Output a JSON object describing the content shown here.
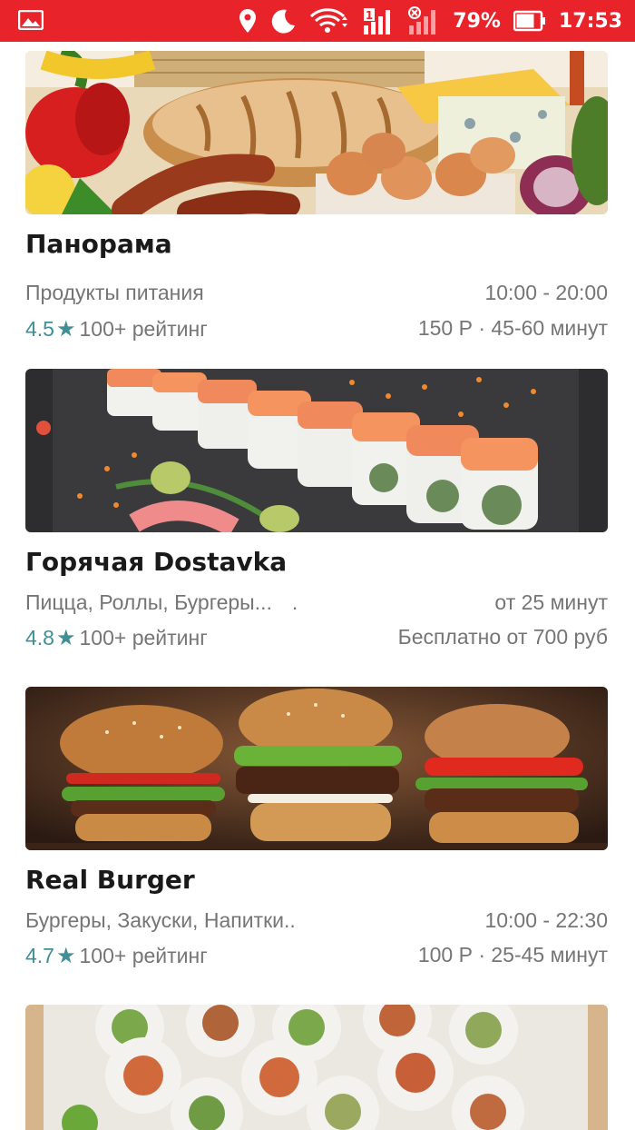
{
  "status_bar": {
    "battery": "79%",
    "time": "17:53",
    "sim_label": "1",
    "icons": [
      "gallery-notification-icon",
      "location-icon",
      "moon-icon",
      "wifi-icon",
      "signal-icon",
      "no-signal-icon",
      "battery-icon"
    ],
    "color": "#e8232a"
  },
  "restaurants": [
    {
      "name": "Панорама",
      "categories": "Продукты питания",
      "hours": "10:00 - 20:00",
      "rating": "4.5",
      "rating_count": "100+ рейтинг",
      "delivery": "150 Р · 45-60 минут",
      "image": "groceries-photo"
    },
    {
      "name": "Горячая Dostavka",
      "categories": "Пицца, Роллы, Бургеры...",
      "extra_dot": ".",
      "hours": "от 25 минут",
      "rating": "4.8",
      "rating_count": "100+ рейтинг",
      "delivery": "Бесплатно от 700 руб",
      "image": "sushi-rolls-photo"
    },
    {
      "name": "Real Burger",
      "categories": "Бургеры, Закуски, Напитки..",
      "hours": "10:00 - 22:30",
      "rating": "4.7",
      "rating_count": "100+ рейтинг",
      "delivery": "100 Р · 25-45 минут",
      "image": "burgers-photo"
    },
    {
      "image": "sushi-photo"
    }
  ],
  "colors": {
    "accent": "#3f8f95",
    "title": "#1a1a1a",
    "secondary": "#757575"
  }
}
